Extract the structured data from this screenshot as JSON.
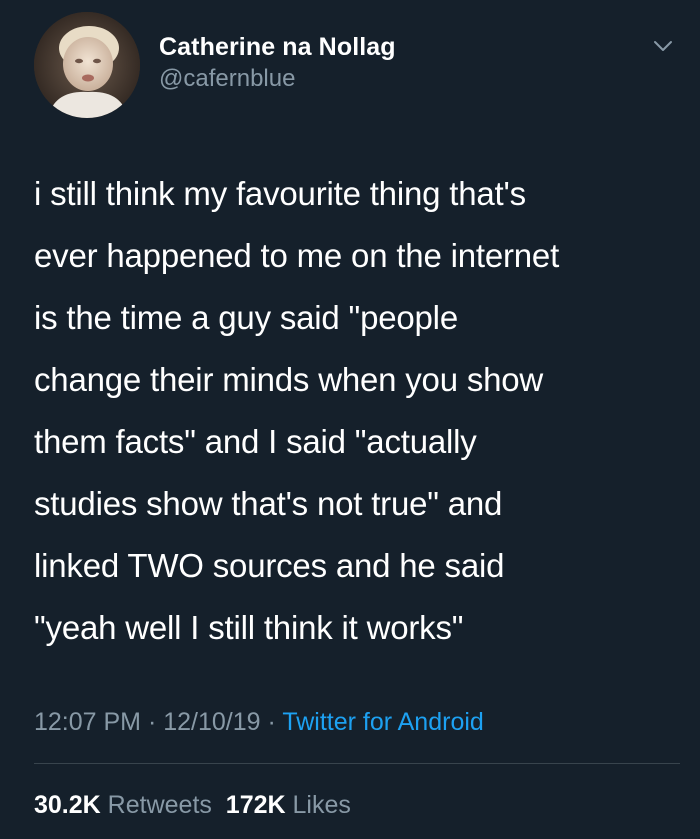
{
  "user": {
    "display_name": "Catherine na Nollag",
    "handle": "@cafernblue"
  },
  "tweet": {
    "text": "i still think my favourite thing that's\never happened to me on the internet\nis the time a guy said \"people\nchange their minds when you show\nthem facts\" and I said \"actually\nstudies show that's not true\" and\nlinked TWO sources and he said\n\"yeah well I still think it works\""
  },
  "meta": {
    "time": "12:07 PM",
    "separator": " · ",
    "date": "12/10/19",
    "source": "Twitter for Android"
  },
  "stats": {
    "retweets_count": "30.2K",
    "retweets_label": "Retweets",
    "likes_count": "172K",
    "likes_label": "Likes"
  },
  "icons": {
    "menu": "chevron-down-icon",
    "avatar": "avatar"
  },
  "colors": {
    "background": "#15202b",
    "text_primary": "#ffffff",
    "text_secondary": "#8899a6",
    "link": "#1da1f2",
    "divider": "#38444d"
  }
}
